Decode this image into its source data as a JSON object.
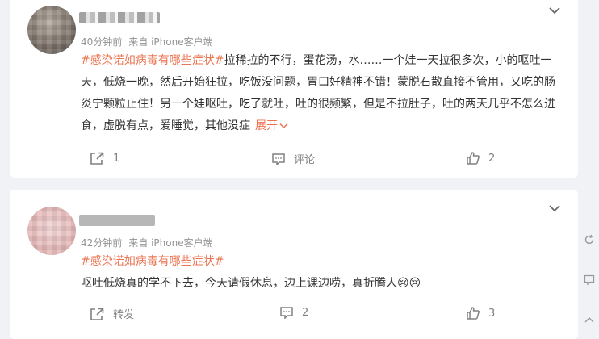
{
  "comments": [
    {
      "meta_time": "40分钟前",
      "meta_source": "来自 iPhone客户端",
      "hashtag": "#感染诺如病毒有哪些症状#",
      "body": "拉稀拉的不行，蛋花汤，水……一个娃一天拉很多次，小的呕吐一天，低烧一晚，然后开始狂拉，吃饭没问题，胃口好精神不错！蒙脱石散直接不管用，又吃的肠炎宁颗粒止住！另一个娃呕吐，吃了就吐，吐的很频繁，但是不拉肚子，吐的两天几乎不怎么进食，虚脱有点，爱睡觉，其他没症",
      "expand_label": "展开",
      "share_label": "1",
      "comment_label": "评论",
      "like_count": "2"
    },
    {
      "meta_time": "42分钟前",
      "meta_source": "来自 iPhone客户端",
      "hashtag": "#感染诺如病毒有哪些症状#",
      "body": "呕吐低烧真的学不下去，今天请假休息，边上课边唠，真折腾人",
      "emoji": "😢😢",
      "share_label": "转发",
      "comment_label": "2",
      "like_count": "3"
    }
  ],
  "colors": {
    "accent": "#eb7350",
    "meta": "#939393",
    "icon": "#808080",
    "background": "#f1f2f5"
  },
  "icons": [
    "chevron-down-icon",
    "share-icon",
    "comment-icon",
    "like-icon",
    "refresh-icon",
    "comment-side-icon"
  ]
}
